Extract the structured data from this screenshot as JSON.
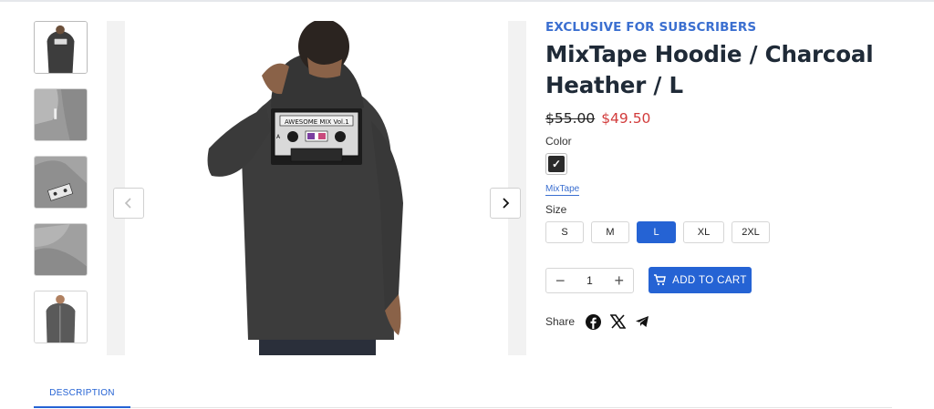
{
  "product": {
    "badge": "EXCLUSIVE FOR SUBSCRIBERS",
    "title_line1": "MixTape Hoodie / Charcoal",
    "title_line2": "Heather / L",
    "price_original": "$55.00",
    "price_sale": "$49.50"
  },
  "color": {
    "label": "Color",
    "selected_mark": "✓",
    "selected_name": "MixTape",
    "swatch_color": "#2b2b2b"
  },
  "size": {
    "label": "Size",
    "options": [
      "S",
      "M",
      "L",
      "XL",
      "2XL"
    ],
    "selected": "L"
  },
  "quantity": {
    "value": "1",
    "minus": "−",
    "plus": "+"
  },
  "cart": {
    "label": "ADD TO CART",
    "icon": "cart-icon"
  },
  "share": {
    "label": "Share",
    "icons": [
      "facebook-icon",
      "x-icon",
      "telegram-icon"
    ]
  },
  "tabs": [
    {
      "label": "DESCRIPTION",
      "active": true
    }
  ],
  "gallery": {
    "thumbnails": [
      "hoodie-back-model",
      "hoodie-detail-zipper",
      "hoodie-cassette-patch",
      "hoodie-fabric-detail",
      "hoodie-front-model"
    ],
    "active_index": 0,
    "cassette_text": "AWESOME MIX Vol.1"
  },
  "colors": {
    "accent": "#2563d4",
    "badge": "#3b6fd0",
    "sale": "#d23b3b",
    "hoodie": "#3c3c3c"
  }
}
